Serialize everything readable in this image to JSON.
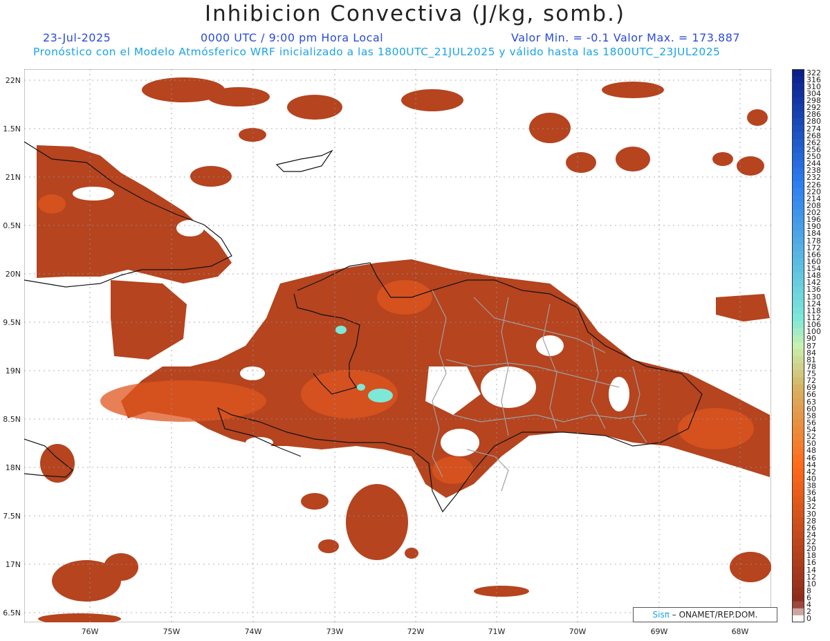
{
  "header": {
    "title": "Inhibicion Convectiva (J/kg, somb.)",
    "date": "23-Jul-2025",
    "time": "0000 UTC / 9:00 pm Hora Local",
    "minmax": "Valor Min. = -0.1  Valor Max. = 173.887",
    "description": "Pronóstico con el Modelo Atmósferico WRF inicializado a las 1800UTC_21JUL2025 y válido hasta las  1800UTC_23JUL2025"
  },
  "axes": {
    "lat_labels": [
      "22N",
      "1.5N",
      "21N",
      "0.5N",
      "20N",
      "9.5N",
      "19N",
      "8.5N",
      "18N",
      "7.5N",
      "17N",
      "6.5N"
    ],
    "lon_labels": [
      "76W",
      "75W",
      "74W",
      "73W",
      "72W",
      "71W",
      "70W",
      "69W",
      "68W"
    ]
  },
  "legend": {
    "labels": [
      "322",
      "316",
      "310",
      "304",
      "298",
      "292",
      "286",
      "280",
      "274",
      "268",
      "262",
      "256",
      "250",
      "244",
      "238",
      "232",
      "226",
      "220",
      "214",
      "208",
      "202",
      "196",
      "190",
      "184",
      "178",
      "172",
      "166",
      "160",
      "154",
      "148",
      "142",
      "136",
      "130",
      "124",
      "118",
      "112",
      "106",
      "100",
      "90",
      "87",
      "84",
      "81",
      "78",
      "75",
      "72",
      "69",
      "66",
      "63",
      "60",
      "58",
      "56",
      "54",
      "52",
      "50",
      "48",
      "46",
      "44",
      "42",
      "40",
      "38",
      "36",
      "34",
      "32",
      "30",
      "28",
      "26",
      "24",
      "22",
      "20",
      "18",
      "16",
      "14",
      "12",
      "10",
      "8",
      "6",
      "4",
      "2",
      "0"
    ],
    "colors_top": "#0a1f8a",
    "colors_mid": "#7de8d8",
    "colors_low": "#ff6a1a",
    "colors_bottom": "#8a2a1c"
  },
  "credit": {
    "sis": "Sisπ",
    "text": " – ONAMET/REP.DOM."
  }
}
